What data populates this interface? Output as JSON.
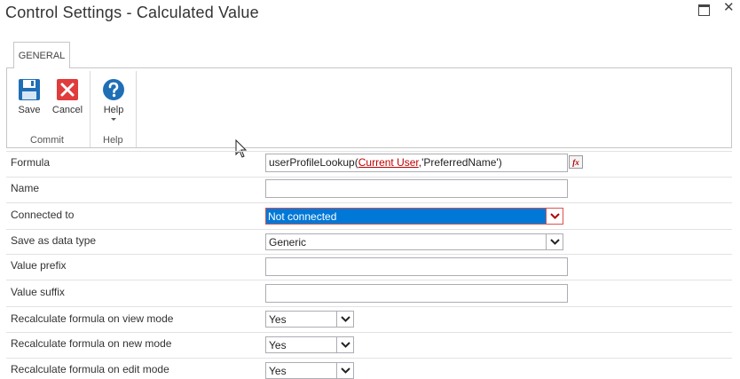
{
  "window": {
    "title": "Control Settings - Calculated Value",
    "maximize_icon": "maximize-icon",
    "close_icon": "close-icon",
    "close_glyph": "✕"
  },
  "ribbon": {
    "tab": "GENERAL",
    "save_label": "Save",
    "cancel_label": "Cancel",
    "help_label": "Help",
    "commit_group": "Commit",
    "help_group": "Help"
  },
  "form": {
    "formula_label": "Formula",
    "formula_prefix": "userProfileLookup(",
    "formula_token": "Current User",
    "formula_suffix": ",'PreferredName')",
    "formula_button": "fx",
    "name_label": "Name",
    "name_value": "",
    "connected_label": "Connected to",
    "connected_value": "Not connected",
    "datatype_label": "Save as data type",
    "datatype_value": "Generic",
    "prefix_label": "Value prefix",
    "prefix_value": "",
    "suffix_label": "Value suffix",
    "suffix_value": "",
    "view_label": "Recalculate formula on view mode",
    "view_value": "Yes",
    "new_label": "Recalculate formula on new mode",
    "new_value": "Yes",
    "edit_label": "Recalculate formula on edit mode",
    "edit_value": "Yes"
  },
  "colors": {
    "save_icon": "#1f6fb6",
    "cancel_icon": "#e03c3c",
    "help_icon": "#1f6fb6",
    "selection": "#0078d7"
  }
}
